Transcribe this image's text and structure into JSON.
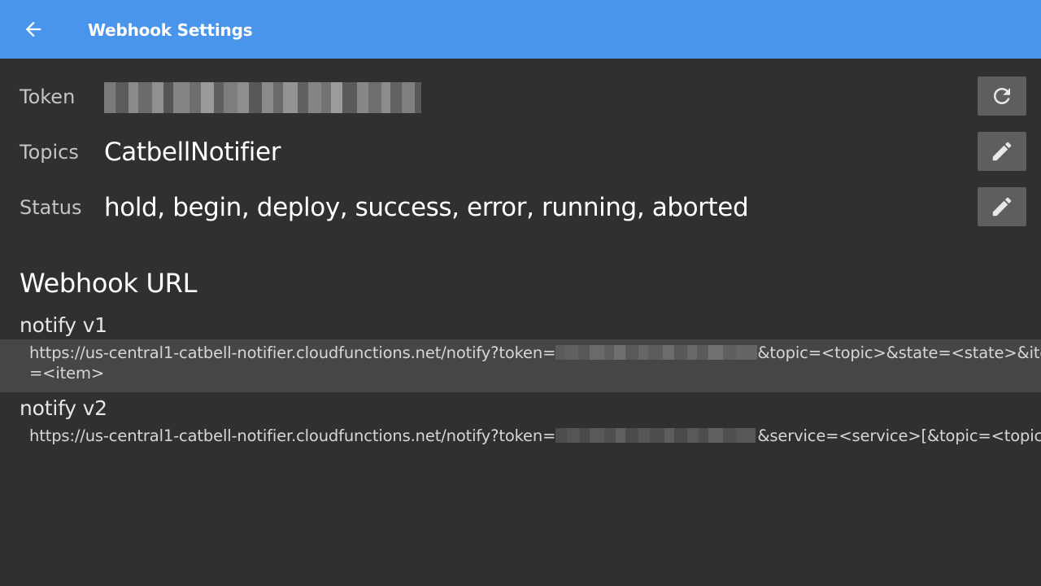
{
  "appbar": {
    "title": "Webhook Settings",
    "back_icon": "arrow-back-icon",
    "color": "#4a95ec"
  },
  "settings": {
    "token": {
      "label": "Token",
      "value_redacted": true,
      "action_icon": "refresh-icon"
    },
    "topics": {
      "label": "Topics",
      "value": "CatbellNotifier",
      "action_icon": "edit-pencil-icon"
    },
    "status": {
      "label": "Status",
      "value": "hold, begin, deploy, success, error, running, aborted",
      "action_icon": "edit-pencil-icon"
    }
  },
  "webhook": {
    "section_title": "Webhook URL",
    "v1": {
      "title": "notify v1",
      "url_prefix": "https://us-central1-catbell-notifier.cloudfunctions.net/notify?token=",
      "url_suffix_line1": "&topic=<topic>&state=<state>&item",
      "url_suffix_line2": "=<item>"
    },
    "v2": {
      "title": "notify v2",
      "url_prefix": "https://us-central1-catbell-notifier.cloudfunctions.net/notify?token=",
      "url_suffix": "&service=<service>[&topic=<topic>]"
    }
  },
  "colors": {
    "background": "#303030",
    "button_bg": "#5e5e5e",
    "highlight_row": "#464646"
  }
}
